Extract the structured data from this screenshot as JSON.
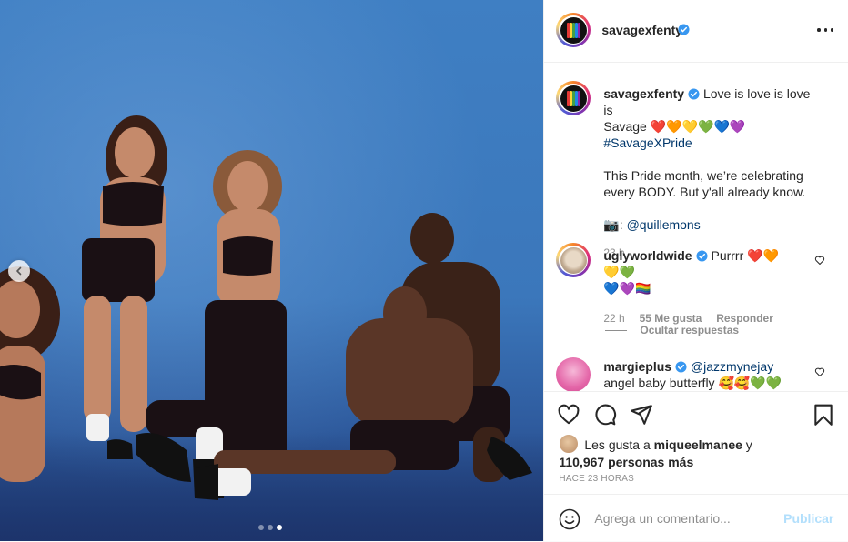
{
  "post": {
    "author": "savagexfenty",
    "caption": {
      "author": "savagexfenty",
      "line1": "Love is love is love is",
      "line2_prefix": "Savage",
      "hearts": "❤️🧡💛💚💙💜",
      "hashtag": "#SavageXPride",
      "paragraph": "This Pride month, we’re celebrating every BODY. But y'all already know.",
      "credit_icon": "📷:",
      "credit_handle": "@quillemons",
      "time": "23 h"
    },
    "comments": [
      {
        "author": "uglyworldwide",
        "text_line1": "Purrrr ❤️🧡💛💚",
        "text_line2": "💙💜🏳️‍🌈",
        "time": "22 h",
        "likes": "55 Me gusta",
        "reply_label": "Responder",
        "hide_replies_label": "Ocultar respuestas"
      },
      {
        "author": "margieplus",
        "mention": "@jazzmynejay",
        "text_line2": "angel baby butterfly 🥰🥰💚💚"
      }
    ],
    "likes": {
      "prefix": "Les gusta a",
      "liker": "miqueelmanee",
      "conj": "y",
      "count": "110,967",
      "suffix": "personas más"
    },
    "time_ago": "HACE 23 HORAS",
    "add_comment_placeholder": "Agrega un comentario...",
    "publish_label": "Publicar"
  },
  "carousel": {
    "slide_count": 3,
    "active_index": 2
  },
  "colors": {
    "verified": "#3897f0",
    "link": "#00376b",
    "meta": "#8e8e8e",
    "publish_disabled": "#b2dffc",
    "photo_background": "#3f7fc3"
  },
  "icons": [
    "chevron-left-icon",
    "more-icon",
    "verified-icon",
    "heart-icon",
    "comment-icon",
    "share-icon",
    "bookmark-icon",
    "emoji-icon"
  ]
}
